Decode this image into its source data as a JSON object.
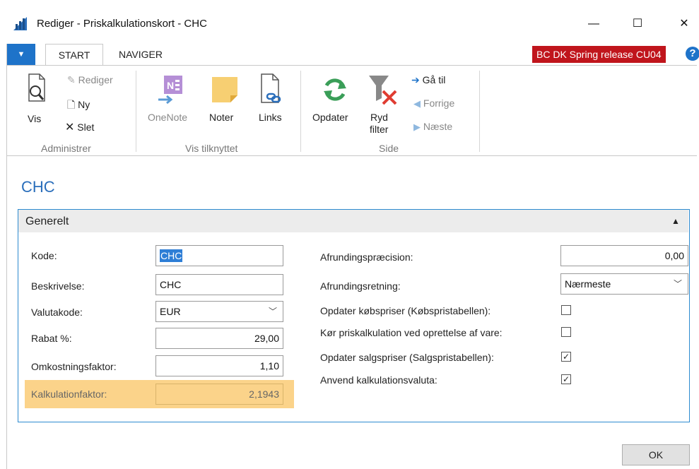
{
  "window": {
    "title": "Rediger - Priskalkulationskort - CHC",
    "minimize_symbol": "—",
    "maximize_symbol": "☐",
    "close_symbol": "✕"
  },
  "ribbon": {
    "tabs": [
      {
        "label": "START"
      },
      {
        "label": "NAVIGER"
      }
    ],
    "release_badge": "BC DK Spring release CU04",
    "help_symbol": "?",
    "groups": {
      "administrer": {
        "label": "Administrer",
        "vis": "Vis",
        "rediger": "Rediger",
        "ny": "Ny",
        "slet": "Slet"
      },
      "vis_tilknyttet": {
        "label": "Vis tilknyttet",
        "onenote": "OneNote",
        "noter": "Noter",
        "links": "Links"
      },
      "side": {
        "label": "Side",
        "opdater": "Opdater",
        "ryd_filter_1": "Ryd",
        "ryd_filter_2": "filter",
        "ga_til": "Gå til",
        "forrige": "Forrige",
        "naeste": "Næste"
      }
    }
  },
  "page": {
    "title": "CHC",
    "fasttab_title": "Generelt",
    "left_fields": [
      {
        "label": "Kode:",
        "value": "CHC"
      },
      {
        "label": "Beskrivelse:",
        "value": "CHC"
      },
      {
        "label": "Valutakode:",
        "value": "EUR"
      },
      {
        "label": "Rabat %:",
        "value": "29,00"
      },
      {
        "label": "Omkostningsfaktor:",
        "value": "1,10"
      },
      {
        "label": "Kalkulationfaktor:",
        "value": "2,1943"
      }
    ],
    "right_fields": [
      {
        "label": "Afrundingspræcision:",
        "value": "0,00"
      },
      {
        "label": "Afrundingsretning:",
        "value": "Nærmeste"
      },
      {
        "label": "Opdater købspriser (Købspristabellen):",
        "checked": false
      },
      {
        "label": "Kør priskalkulation ved oprettelse af vare:",
        "checked": false
      },
      {
        "label": "Opdater salgspriser (Salgspristabellen):",
        "checked": true
      },
      {
        "label": "Anvend kalkulationsvaluta:",
        "checked": true
      }
    ],
    "ok_label": "OK"
  },
  "colors": {
    "accent": "#2a6ebb",
    "badge": "#c0151c",
    "highlight": "#fbd38a",
    "fasttab_border": "#2d8bd0"
  }
}
